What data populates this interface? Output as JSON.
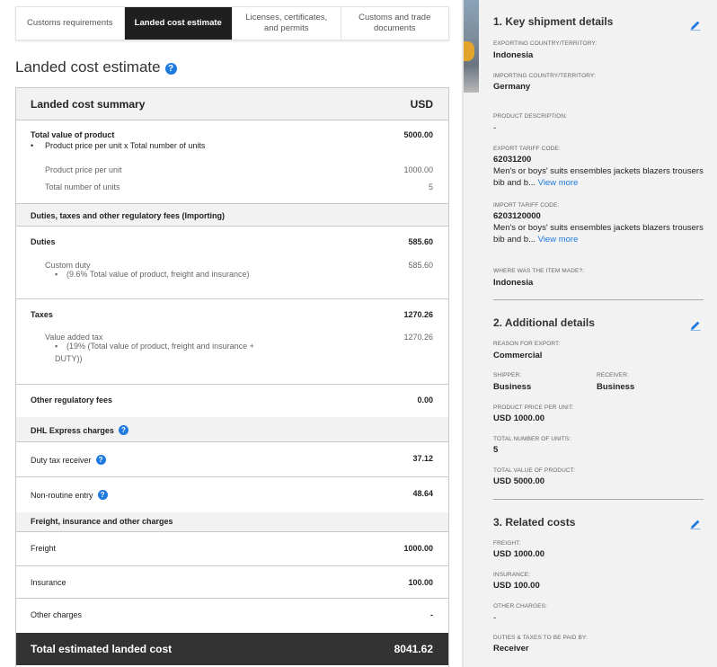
{
  "tabs": [
    {
      "label": "Customs requirements"
    },
    {
      "label": "Landed cost estimate"
    },
    {
      "label": "Licenses, certificates, and permits"
    },
    {
      "label": "Customs and trade documents"
    }
  ],
  "page_title": "Landed cost estimate",
  "summary": {
    "title": "Landed cost summary",
    "currency": "USD",
    "total_value": {
      "label": "Total value of product",
      "value": "5000.00",
      "bullet": "Product price per unit x Total number of units",
      "price_per_unit_label": "Product price per unit",
      "price_per_unit_value": "1000.00",
      "units_label": "Total number of units",
      "units_value": "5"
    },
    "duties_section": "Duties, taxes and other regulatory fees (Importing)",
    "duties": {
      "label": "Duties",
      "value": "585.60",
      "sub_label": "Custom duty",
      "sub_value": "585.60",
      "bullet": "(9.6% Total value of product, freight and insurance)"
    },
    "taxes": {
      "label": "Taxes",
      "value": "1270.26",
      "sub_label": "Value added tax",
      "sub_value": "1270.26",
      "bullet_line1": "(19% (Total value of product, freight and insurance +",
      "bullet_line2": "DUTY))"
    },
    "other_fees": {
      "label": "Other regulatory fees",
      "value": "0.00"
    },
    "dhl_section": "DHL Express charges",
    "duty_tax_receiver": {
      "label": "Duty tax receiver",
      "value": "37.12"
    },
    "non_routine_entry": {
      "label": "Non-routine entry",
      "value": "48.64"
    },
    "freight_section": "Freight, insurance and other charges",
    "freight": {
      "label": "Freight",
      "value": "1000.00"
    },
    "insurance": {
      "label": "Insurance",
      "value": "100.00"
    },
    "other_charges": {
      "label": "Other charges",
      "value": "-"
    },
    "total": {
      "label": "Total estimated landed cost",
      "value": "8041.62"
    }
  },
  "right": {
    "section1": {
      "title": "1. Key shipment details",
      "exporting_label": "EXPORTING COUNTRY/TERRITORY:",
      "exporting_value": "Indonesia",
      "importing_label": "IMPORTING COUNTRY/TERRITORY:",
      "importing_value": "Germany",
      "product_desc_label": "PRODUCT DESCRIPTION:",
      "product_desc_value": "-",
      "export_tariff_label": "EXPORT TARIFF CODE:",
      "export_tariff_value": "62031200",
      "export_tariff_desc": "Men's or boys' suits ensembles jackets blazers trousers bib and b...",
      "import_tariff_label": "IMPORT TARIFF CODE:",
      "import_tariff_value": "6203120000",
      "import_tariff_desc": "Men's or boys' suits ensembles jackets blazers trousers bib and b...",
      "view_more": "View more",
      "made_label": "WHERE WAS THE ITEM MADE?:",
      "made_value": "Indonesia"
    },
    "section2": {
      "title": "2. Additional details",
      "reason_label": "REASON FOR EXPORT:",
      "reason_value": "Commercial",
      "shipper_label": "SHIPPER:",
      "shipper_value": "Business",
      "receiver_label": "RECEIVER:",
      "receiver_value": "Business",
      "price_label": "PRODUCT PRICE PER UNIT:",
      "price_value": "USD 1000.00",
      "units_label": "TOTAL NUMBER OF UNITS:",
      "units_value": "5",
      "total_label": "TOTAL VALUE OF PRODUCT:",
      "total_value": "USD 5000.00"
    },
    "section3": {
      "title": "3. Related costs",
      "freight_label": "FREIGHT:",
      "freight_value": "USD 1000.00",
      "insurance_label": "INSURANCE:",
      "insurance_value": "USD 100.00",
      "other_label": "OTHER CHARGES:",
      "other_value": "-",
      "paid_by_label": "DUTIES & TAXES TO BE PAID BY:",
      "paid_by_value": "Receiver"
    }
  },
  "colors": {
    "accent": "#1f7ae0",
    "tab_active": "#1f1f1f",
    "total_bar": "#333333"
  },
  "icons": {
    "help": "question-circle-icon",
    "edit": "pencil-icon"
  }
}
